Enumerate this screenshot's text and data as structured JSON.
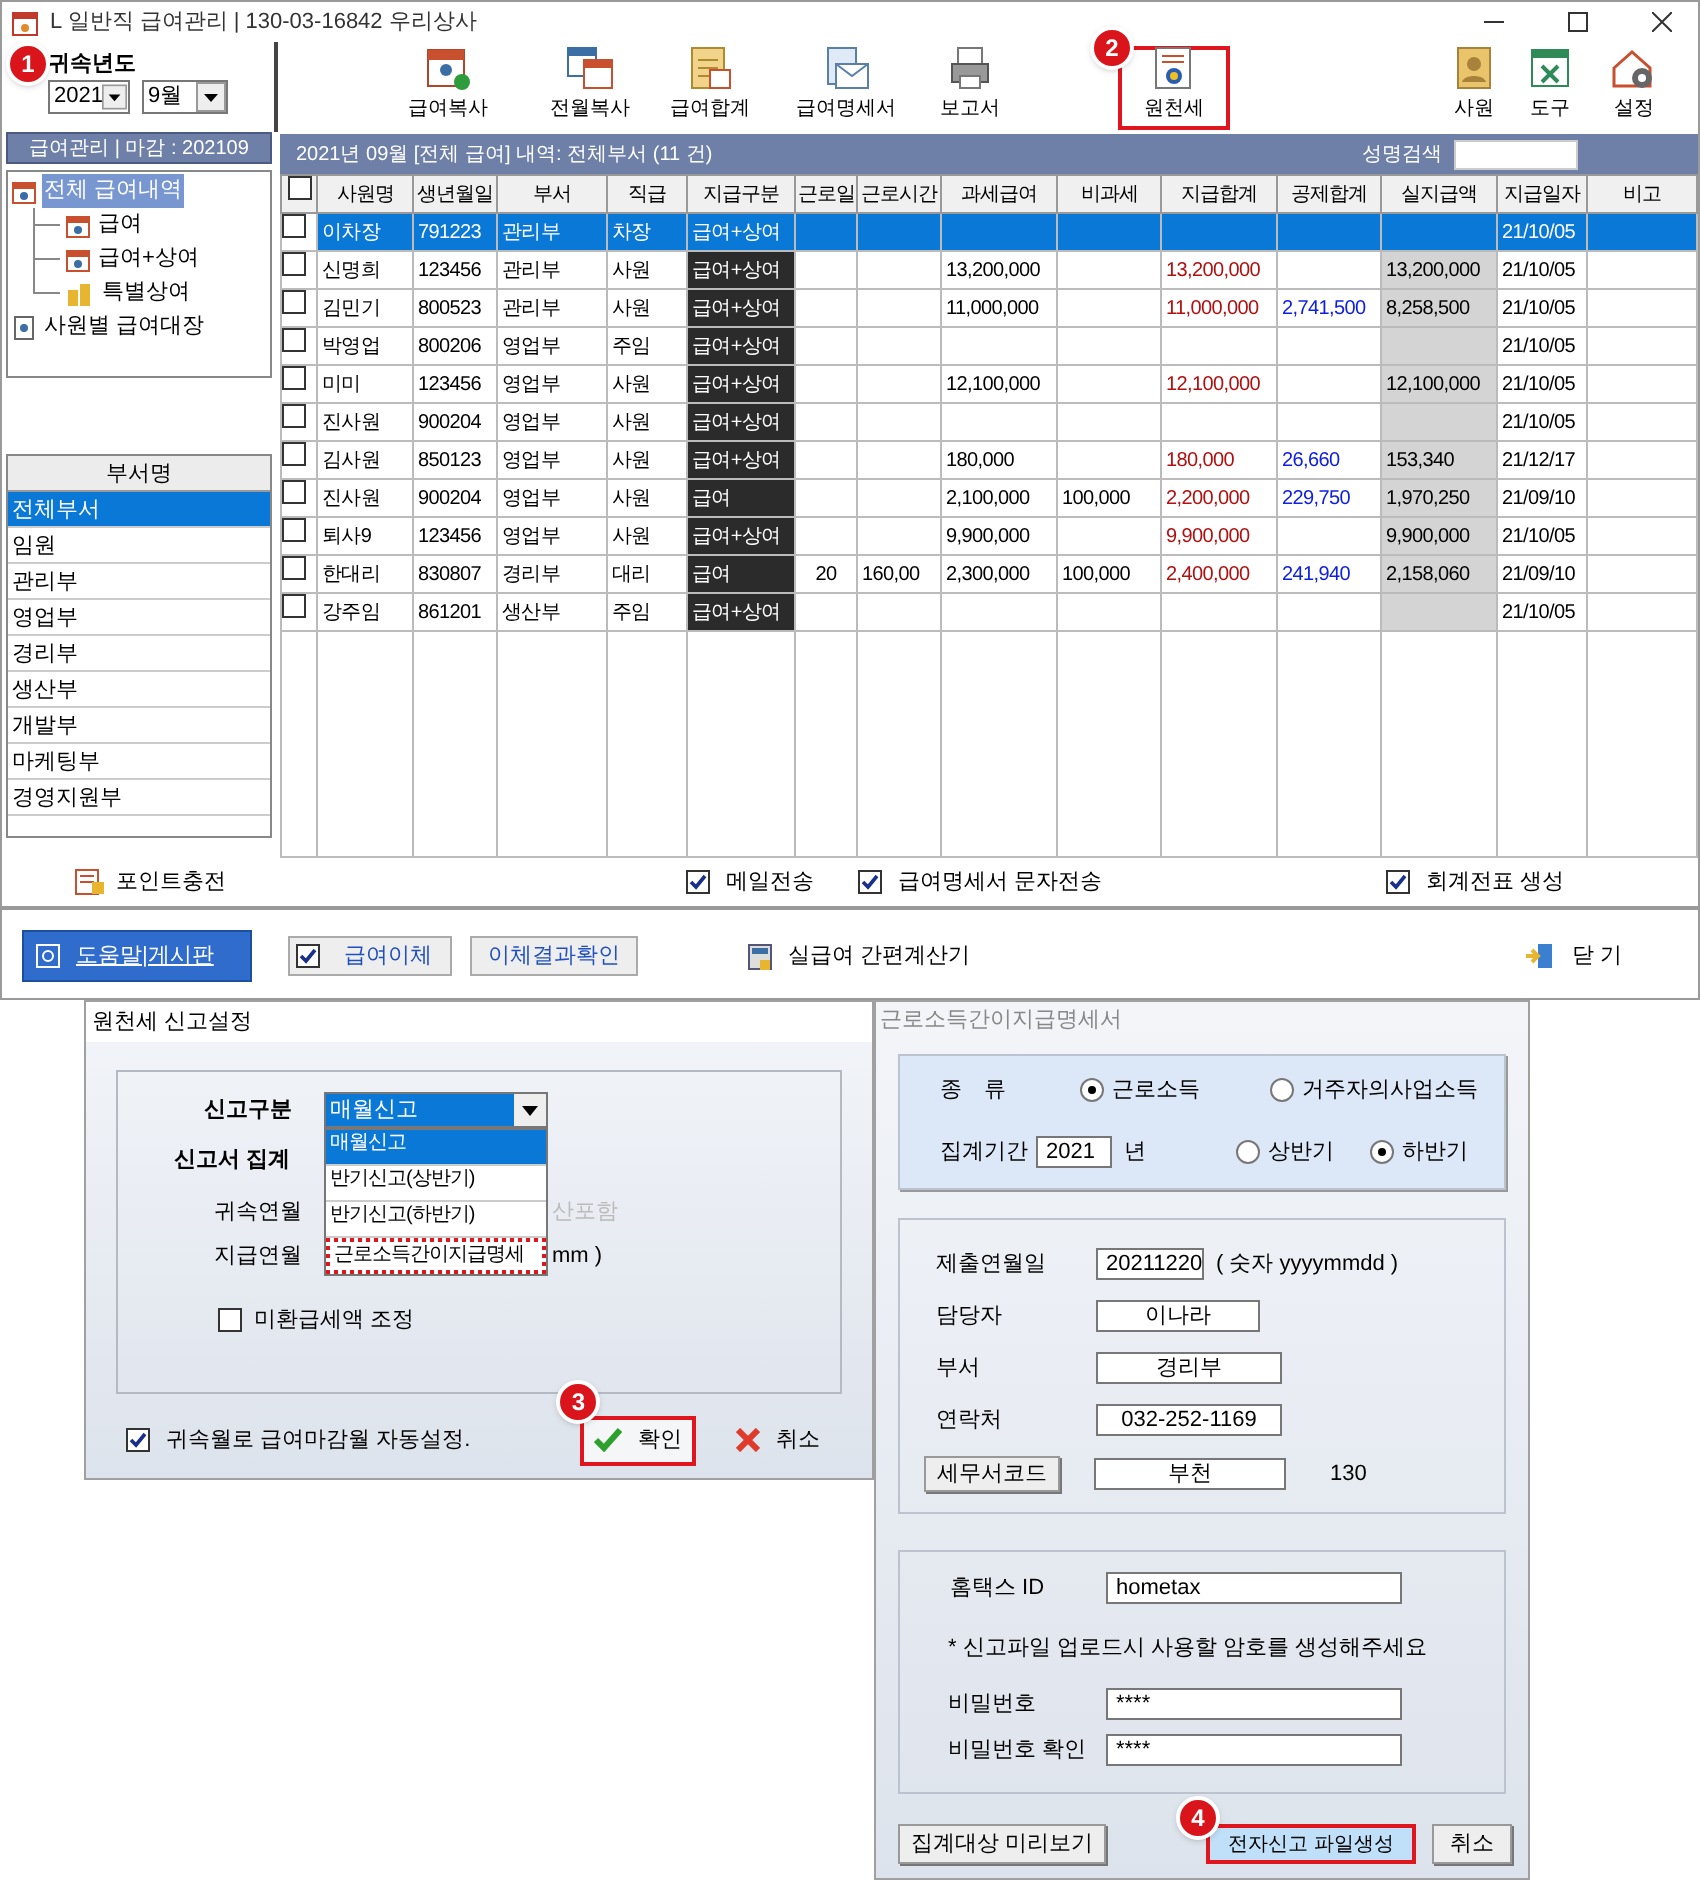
{
  "window": {
    "title": "L 일반직 급여관리 | 130-03-16842  우리상사"
  },
  "period": {
    "label": "귀속년도",
    "year": "2021",
    "month": "9월",
    "step": "1"
  },
  "toolbar": [
    {
      "label": "급여복사",
      "highlighted": false
    },
    {
      "label": "전월복사",
      "highlighted": false
    },
    {
      "label": "급여합계",
      "highlighted": false
    },
    {
      "label": "급여명세서",
      "highlighted": false
    },
    {
      "label": "보고서",
      "highlighted": false
    },
    {
      "label": "원천세",
      "highlighted": true,
      "step": "2"
    },
    {
      "label": "사원",
      "highlighted": false
    },
    {
      "label": "도구",
      "highlighted": false
    },
    {
      "label": "설정",
      "highlighted": false
    }
  ],
  "sidebar": {
    "header": "급여관리 | 마감 : 202109",
    "tree": [
      {
        "label": "전체 급여내역",
        "selected": true,
        "children": [
          {
            "label": "급여",
            "selected": false
          },
          {
            "label": "급여+상여",
            "selected": false
          },
          {
            "label": "특별상여",
            "selected": false
          }
        ]
      },
      {
        "label": "사원별 급여대장",
        "selected": false
      }
    ],
    "departments_header": "부서명",
    "departments": [
      {
        "label": "전체부서",
        "selected": true
      },
      {
        "label": "임원",
        "selected": false
      },
      {
        "label": "관리부",
        "selected": false
      },
      {
        "label": "영업부",
        "selected": false
      },
      {
        "label": "경리부",
        "selected": false
      },
      {
        "label": "생산부",
        "selected": false
      },
      {
        "label": "개발부",
        "selected": false
      },
      {
        "label": "마케팅부",
        "selected": false
      },
      {
        "label": "경영지원부",
        "selected": false
      }
    ]
  },
  "table": {
    "caption": "2021년 09월 [전체 급여] 내역: 전체부서  (11 건)",
    "search_label": "성명검색",
    "all_checked": false,
    "columns": [
      "사원명",
      "생년월일",
      "부서",
      "직급",
      "지급구분",
      "근로일",
      "근로시간",
      "과세급여",
      "비과세",
      "지급합계",
      "공제합계",
      "실지급액",
      "지급일자",
      "비고"
    ],
    "rows": [
      {
        "selected": true,
        "checked": false,
        "name": "이차장",
        "birth": "791223",
        "dept": "관리부",
        "position": "차장",
        "pay_type": "급여+상여",
        "pay_date": "21/10/05"
      },
      {
        "selected": false,
        "checked": false,
        "name": "신명희",
        "birth": "123456",
        "dept": "관리부",
        "position": "사원",
        "pay_type": "급여+상여",
        "taxable": "13,200,000",
        "total_pay": "13,200,000",
        "net_pay": "13,200,000",
        "pay_date": "21/10/05"
      },
      {
        "selected": false,
        "checked": false,
        "name": "김민기",
        "birth": "800523",
        "dept": "관리부",
        "position": "사원",
        "pay_type": "급여+상여",
        "taxable": "11,000,000",
        "total_pay": "11,000,000",
        "deduction": "2,741,500",
        "net_pay": "8,258,500",
        "pay_date": "21/10/05"
      },
      {
        "selected": false,
        "checked": false,
        "name": "박영업",
        "birth": "800206",
        "dept": "영업부",
        "position": "주임",
        "pay_type": "급여+상여",
        "pay_date": "21/10/05"
      },
      {
        "selected": false,
        "checked": false,
        "name": "미미",
        "birth": "123456",
        "dept": "영업부",
        "position": "사원",
        "pay_type": "급여+상여",
        "taxable": "12,100,000",
        "total_pay": "12,100,000",
        "net_pay": "12,100,000",
        "pay_date": "21/10/05"
      },
      {
        "selected": false,
        "checked": false,
        "name": "진사원",
        "birth": "900204",
        "dept": "영업부",
        "position": "사원",
        "pay_type": "급여+상여",
        "pay_date": "21/10/05"
      },
      {
        "selected": false,
        "checked": false,
        "name": "김사원",
        "birth": "850123",
        "dept": "영업부",
        "position": "사원",
        "pay_type": "급여+상여",
        "taxable": "180,000",
        "total_pay": "180,000",
        "deduction": "26,660",
        "net_pay": "153,340",
        "pay_date": "21/12/17"
      },
      {
        "selected": false,
        "checked": false,
        "name": "진사원",
        "birth": "900204",
        "dept": "영업부",
        "position": "사원",
        "pay_type": "급여",
        "taxable": "2,100,000",
        "nontaxable": "100,000",
        "total_pay": "2,200,000",
        "deduction": "229,750",
        "net_pay": "1,970,250",
        "pay_date": "21/09/10"
      },
      {
        "selected": false,
        "checked": false,
        "name": "퇴사9",
        "birth": "123456",
        "dept": "영업부",
        "position": "사원",
        "pay_type": "급여+상여",
        "taxable": "9,900,000",
        "total_pay": "9,900,000",
        "net_pay": "9,900,000",
        "pay_date": "21/10/05"
      },
      {
        "selected": false,
        "checked": false,
        "name": "한대리",
        "birth": "830807",
        "dept": "경리부",
        "position": "대리",
        "pay_type": "급여",
        "work_days": "20",
        "work_hours": "160,00",
        "taxable": "2,300,000",
        "nontaxable": "100,000",
        "total_pay": "2,400,000",
        "deduction": "241,940",
        "net_pay": "2,158,060",
        "pay_date": "21/09/10"
      },
      {
        "selected": false,
        "checked": false,
        "name": "강주임",
        "birth": "861201",
        "dept": "생산부",
        "position": "주임",
        "pay_type": "급여+상여",
        "pay_date": "21/10/05"
      }
    ]
  },
  "options": {
    "point_link": "포인트충전",
    "checks": [
      {
        "label": "메일전송",
        "checked": true
      },
      {
        "label": "급여명세서 문자전송",
        "checked": true
      },
      {
        "label": "회계전표 생성",
        "checked": true
      }
    ]
  },
  "footer": {
    "help": "도움말|게시판",
    "transfer": {
      "label": "급여이체",
      "checked": true
    },
    "transfer_result": "이체결과확인",
    "calculator": "실급여 간편계산기",
    "close": "닫 기"
  },
  "report_dialog": {
    "title": "원천세 신고설정",
    "type_label": "신고구분",
    "type_value": "매월신고",
    "options": [
      {
        "label": "매월신고",
        "selected": true,
        "highlighted": false
      },
      {
        "label": "반기신고(상반기)",
        "selected": false,
        "highlighted": false
      },
      {
        "label": "반기신고(하반기)",
        "selected": false,
        "highlighted": false
      },
      {
        "label": "근로소득간이지급명세",
        "selected": false,
        "highlighted": true
      }
    ],
    "summary_label": "신고서 집계",
    "attr_month_label": "귀속연월",
    "hidden_text": "산포함",
    "pay_month_label": "지급연월",
    "pay_month_suffix": "mm )",
    "adjust": {
      "label": "미환급세액 조정",
      "checked": false
    },
    "auto": {
      "label": "귀속월로 급여마감월 자동설정.",
      "checked": true
    },
    "ok": {
      "label": "확인",
      "highlighted": true,
      "step": "3"
    },
    "cancel": "취소"
  },
  "statement_dialog": {
    "title": "근로소득간이지급명세서",
    "type_label": "종　류",
    "types": [
      {
        "label": "근로소득",
        "selected": true
      },
      {
        "label": "거주자의사업소득",
        "selected": false
      }
    ],
    "period_label": "집계기간",
    "period_year": "2021",
    "year_unit": "년",
    "halves": [
      {
        "label": "상반기",
        "selected": false
      },
      {
        "label": "하반기",
        "selected": true
      }
    ],
    "submit_label": "제출연월일",
    "submit_date": "20211220",
    "submit_hint": "( 숫자 yyyymmdd )",
    "manager_label": "담당자",
    "manager": "이나라",
    "dept_label": "부서",
    "dept": "경리부",
    "phone_label": "연락처",
    "phone": "032-252-1169",
    "tax_office_button": "세무서코드",
    "tax_office": "부천",
    "tax_office_code": "130",
    "hometax_label": "홈택스 ID",
    "hometax_id": "hometax",
    "note": "* 신고파일 업로드시 사용할 암호를 생성해주세요",
    "password_label": "비밀번호",
    "password": "****",
    "confirm_label": "비밀번호 확인",
    "confirm": "****",
    "preview": "집계대상 미리보기",
    "create": {
      "label": "전자신고 파일생성",
      "highlighted": true,
      "step": "4"
    },
    "cancel": "취소"
  }
}
